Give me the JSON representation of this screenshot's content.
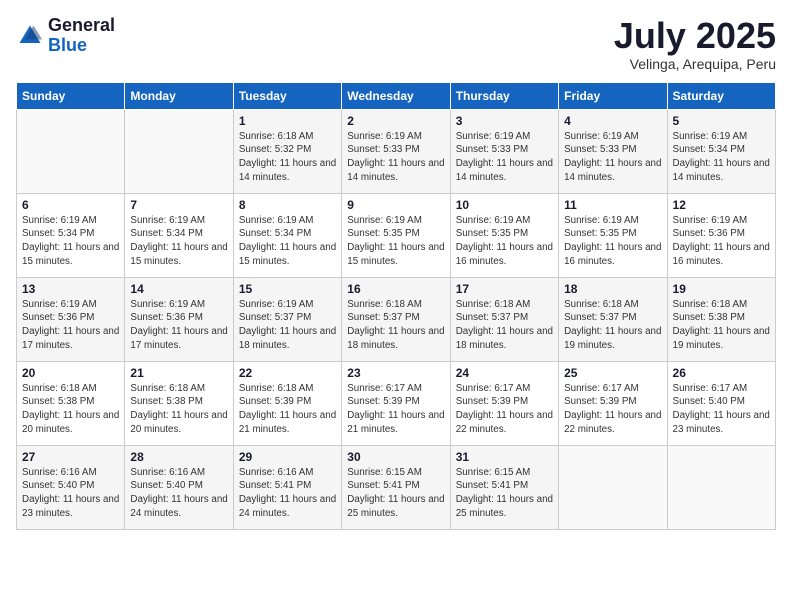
{
  "logo": {
    "general": "General",
    "blue": "Blue"
  },
  "header": {
    "month": "July 2025",
    "location": "Velinga, Arequipa, Peru"
  },
  "weekdays": [
    "Sunday",
    "Monday",
    "Tuesday",
    "Wednesday",
    "Thursday",
    "Friday",
    "Saturday"
  ],
  "weeks": [
    [
      {
        "day": null
      },
      {
        "day": null
      },
      {
        "day": 1,
        "sunrise": "6:18 AM",
        "sunset": "5:32 PM",
        "daylight": "11 hours and 14 minutes."
      },
      {
        "day": 2,
        "sunrise": "6:19 AM",
        "sunset": "5:33 PM",
        "daylight": "11 hours and 14 minutes."
      },
      {
        "day": 3,
        "sunrise": "6:19 AM",
        "sunset": "5:33 PM",
        "daylight": "11 hours and 14 minutes."
      },
      {
        "day": 4,
        "sunrise": "6:19 AM",
        "sunset": "5:33 PM",
        "daylight": "11 hours and 14 minutes."
      },
      {
        "day": 5,
        "sunrise": "6:19 AM",
        "sunset": "5:34 PM",
        "daylight": "11 hours and 14 minutes."
      }
    ],
    [
      {
        "day": 6,
        "sunrise": "6:19 AM",
        "sunset": "5:34 PM",
        "daylight": "11 hours and 15 minutes."
      },
      {
        "day": 7,
        "sunrise": "6:19 AM",
        "sunset": "5:34 PM",
        "daylight": "11 hours and 15 minutes."
      },
      {
        "day": 8,
        "sunrise": "6:19 AM",
        "sunset": "5:34 PM",
        "daylight": "11 hours and 15 minutes."
      },
      {
        "day": 9,
        "sunrise": "6:19 AM",
        "sunset": "5:35 PM",
        "daylight": "11 hours and 15 minutes."
      },
      {
        "day": 10,
        "sunrise": "6:19 AM",
        "sunset": "5:35 PM",
        "daylight": "11 hours and 16 minutes."
      },
      {
        "day": 11,
        "sunrise": "6:19 AM",
        "sunset": "5:35 PM",
        "daylight": "11 hours and 16 minutes."
      },
      {
        "day": 12,
        "sunrise": "6:19 AM",
        "sunset": "5:36 PM",
        "daylight": "11 hours and 16 minutes."
      }
    ],
    [
      {
        "day": 13,
        "sunrise": "6:19 AM",
        "sunset": "5:36 PM",
        "daylight": "11 hours and 17 minutes."
      },
      {
        "day": 14,
        "sunrise": "6:19 AM",
        "sunset": "5:36 PM",
        "daylight": "11 hours and 17 minutes."
      },
      {
        "day": 15,
        "sunrise": "6:19 AM",
        "sunset": "5:37 PM",
        "daylight": "11 hours and 18 minutes."
      },
      {
        "day": 16,
        "sunrise": "6:18 AM",
        "sunset": "5:37 PM",
        "daylight": "11 hours and 18 minutes."
      },
      {
        "day": 17,
        "sunrise": "6:18 AM",
        "sunset": "5:37 PM",
        "daylight": "11 hours and 18 minutes."
      },
      {
        "day": 18,
        "sunrise": "6:18 AM",
        "sunset": "5:37 PM",
        "daylight": "11 hours and 19 minutes."
      },
      {
        "day": 19,
        "sunrise": "6:18 AM",
        "sunset": "5:38 PM",
        "daylight": "11 hours and 19 minutes."
      }
    ],
    [
      {
        "day": 20,
        "sunrise": "6:18 AM",
        "sunset": "5:38 PM",
        "daylight": "11 hours and 20 minutes."
      },
      {
        "day": 21,
        "sunrise": "6:18 AM",
        "sunset": "5:38 PM",
        "daylight": "11 hours and 20 minutes."
      },
      {
        "day": 22,
        "sunrise": "6:18 AM",
        "sunset": "5:39 PM",
        "daylight": "11 hours and 21 minutes."
      },
      {
        "day": 23,
        "sunrise": "6:17 AM",
        "sunset": "5:39 PM",
        "daylight": "11 hours and 21 minutes."
      },
      {
        "day": 24,
        "sunrise": "6:17 AM",
        "sunset": "5:39 PM",
        "daylight": "11 hours and 22 minutes."
      },
      {
        "day": 25,
        "sunrise": "6:17 AM",
        "sunset": "5:39 PM",
        "daylight": "11 hours and 22 minutes."
      },
      {
        "day": 26,
        "sunrise": "6:17 AM",
        "sunset": "5:40 PM",
        "daylight": "11 hours and 23 minutes."
      }
    ],
    [
      {
        "day": 27,
        "sunrise": "6:16 AM",
        "sunset": "5:40 PM",
        "daylight": "11 hours and 23 minutes."
      },
      {
        "day": 28,
        "sunrise": "6:16 AM",
        "sunset": "5:40 PM",
        "daylight": "11 hours and 24 minutes."
      },
      {
        "day": 29,
        "sunrise": "6:16 AM",
        "sunset": "5:41 PM",
        "daylight": "11 hours and 24 minutes."
      },
      {
        "day": 30,
        "sunrise": "6:15 AM",
        "sunset": "5:41 PM",
        "daylight": "11 hours and 25 minutes."
      },
      {
        "day": 31,
        "sunrise": "6:15 AM",
        "sunset": "5:41 PM",
        "daylight": "11 hours and 25 minutes."
      },
      {
        "day": null
      },
      {
        "day": null
      }
    ]
  ],
  "labels": {
    "sunrise": "Sunrise:",
    "sunset": "Sunset:",
    "daylight": "Daylight:"
  }
}
